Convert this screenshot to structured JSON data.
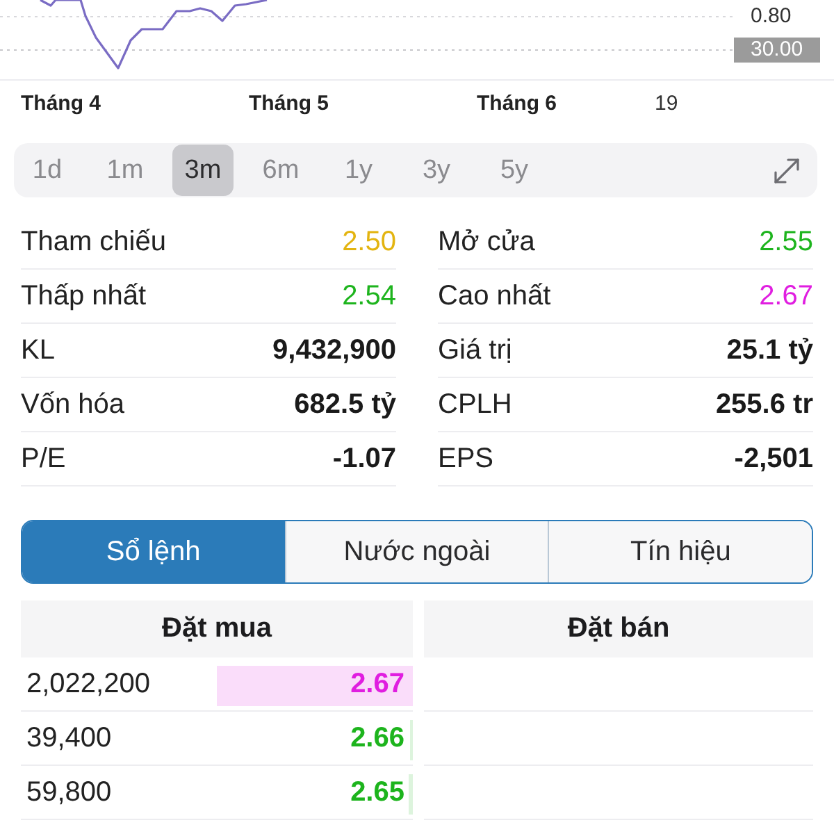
{
  "chart": {
    "y_label": "0.80",
    "price_badge": "30.00",
    "x_labels": [
      {
        "text": "Tháng 4",
        "kind": "month"
      },
      {
        "text": "Tháng 5",
        "kind": "month"
      },
      {
        "text": "Tháng 6",
        "kind": "month"
      },
      {
        "text": "19",
        "kind": "day"
      }
    ]
  },
  "ranges": [
    {
      "label": "1d",
      "selected": false
    },
    {
      "label": "1m",
      "selected": false
    },
    {
      "label": "3m",
      "selected": true
    },
    {
      "label": "6m",
      "selected": false
    },
    {
      "label": "1y",
      "selected": false
    },
    {
      "label": "3y",
      "selected": false
    },
    {
      "label": "5y",
      "selected": false
    }
  ],
  "stats": [
    {
      "label": "Tham chiếu",
      "value": "2.50",
      "kind": "price",
      "color": "#e3b410"
    },
    {
      "label": "Mở cửa",
      "value": "2.55",
      "kind": "price",
      "color": "#1db41d"
    },
    {
      "label": "Thấp nhất",
      "value": "2.54",
      "kind": "price",
      "color": "#1db41d"
    },
    {
      "label": "Cao nhất",
      "value": "2.67",
      "kind": "price",
      "color": "#e01ee0"
    },
    {
      "label": "KL",
      "value": "9,432,900",
      "kind": "figure"
    },
    {
      "label": "Giá trị",
      "value": "25.1 tỷ",
      "kind": "figure"
    },
    {
      "label": "Vốn hóa",
      "value": "682.5 tỷ",
      "kind": "figure"
    },
    {
      "label": "CPLH",
      "value": "255.6 tr",
      "kind": "figure"
    },
    {
      "label": "P/E",
      "value": "-1.07",
      "kind": "figure"
    },
    {
      "label": "EPS",
      "value": "-2,501",
      "kind": "figure"
    }
  ],
  "tabs": [
    {
      "label": "Sổ lệnh",
      "selected": true
    },
    {
      "label": "Nước ngoài",
      "selected": false
    },
    {
      "label": "Tín hiệu",
      "selected": false
    }
  ],
  "order_book": {
    "columns": [
      "Đặt mua",
      "Đặt bán"
    ],
    "bids": [
      {
        "volume": "2,022,200",
        "price": "2.67",
        "color": "#e01ee0",
        "level": 0.5
      },
      {
        "volume": "39,400",
        "price": "2.66",
        "color": "#1db41d",
        "level": 0.008
      },
      {
        "volume": "59,800",
        "price": "2.65",
        "color": "#1db41d",
        "level": 0.01
      }
    ]
  }
}
